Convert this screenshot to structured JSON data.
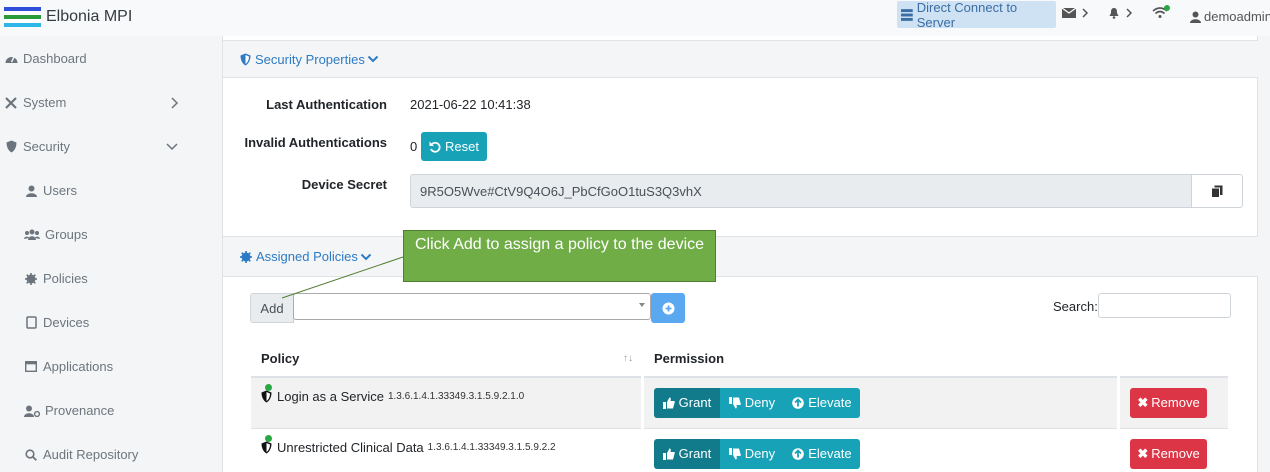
{
  "app": {
    "title": "Elbonia MPI",
    "flag_colors": [
      "#2f4fd8",
      "#ffffff",
      "#2a9a3a",
      "#ffffff",
      "#2fb6e8"
    ]
  },
  "topbar": {
    "direct_connect": "Direct Connect to Server",
    "user": "demoadmin"
  },
  "sidebar": {
    "items": [
      {
        "label": "Dashboard",
        "icon": "tachometer-icon"
      },
      {
        "label": "System",
        "icon": "tools-icon"
      },
      {
        "label": "Security",
        "icon": "shield-icon"
      },
      {
        "label": "Users",
        "icon": "user-icon"
      },
      {
        "label": "Groups",
        "icon": "users-icon"
      },
      {
        "label": "Policies",
        "icon": "certificate-icon"
      },
      {
        "label": "Devices",
        "icon": "tablet-icon"
      },
      {
        "label": "Applications",
        "icon": "window-icon"
      },
      {
        "label": "Provenance",
        "icon": "user-cog-icon"
      },
      {
        "label": "Audit Repository",
        "icon": "search-icon"
      }
    ]
  },
  "security_properties": {
    "header": "Security Properties",
    "last_auth_label": "Last Authentication",
    "last_auth_value": "2021-06-22 10:41:38",
    "invalid_auth_label": "Invalid Authentications",
    "invalid_auth_value": "0",
    "reset_label": "Reset",
    "device_secret_label": "Device Secret",
    "device_secret_value": "9R5O5Wve#CtV9Q4O6J_PbCfGoO1tuS3Q3vhX"
  },
  "assigned_policies": {
    "header": "Assigned Policies",
    "add_label": "Add",
    "search_label": "Search:",
    "columns": {
      "policy": "Policy",
      "permission": "Permission"
    },
    "rows": [
      {
        "name": "Login as a Service",
        "oid": "1.3.6.1.4.1.33349.3.1.5.9.2.1.0"
      },
      {
        "name": "Unrestricted Clinical Data",
        "oid": "1.3.6.1.4.1.33349.3.1.5.9.2.2"
      }
    ],
    "grant": "Grant",
    "deny": "Deny",
    "elevate": "Elevate",
    "remove": "Remove"
  },
  "callout": {
    "text": "Click Add to assign a policy to the device"
  }
}
